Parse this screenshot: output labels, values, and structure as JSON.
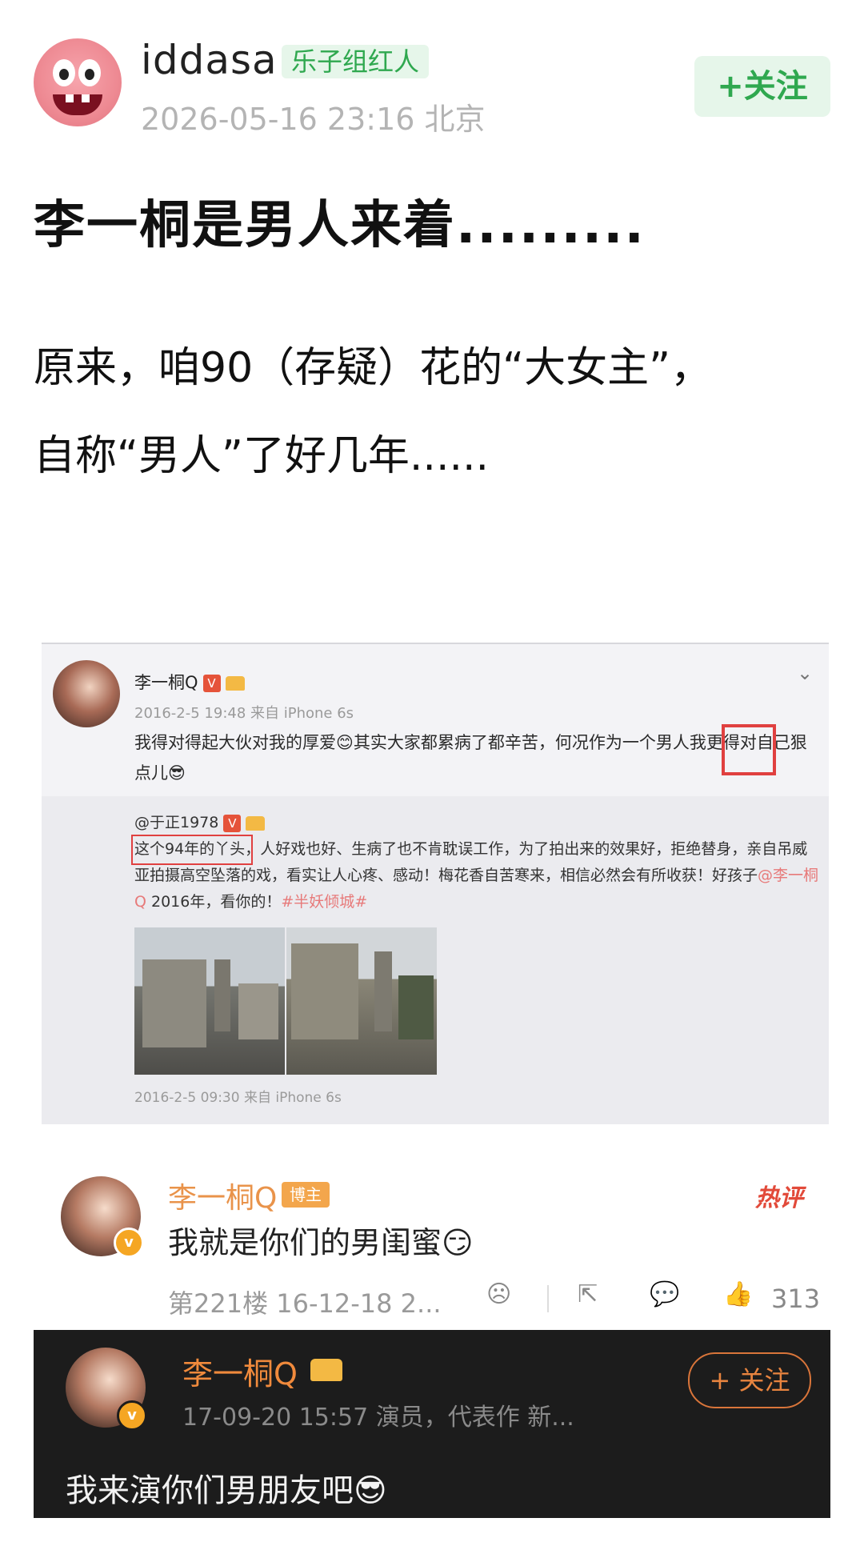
{
  "author": {
    "username": "iddasa",
    "badge": "乐子组红人",
    "meta": "2026-05-16 23:16 北京",
    "follow_label": "+关注"
  },
  "post": {
    "title": "李一桐是男人来着.........",
    "body_line1": "原来，咱90（存疑）花的“大女主”，",
    "body_line2": "自称“男人”了好几年......"
  },
  "screenshot": {
    "name": "李一桐Q",
    "v_label": "V",
    "meta": "2016-2-5 19:48 来自 iPhone 6s",
    "text": "我得对得起大伙对我的厚爱😊其实大家都累病了都辛苦，何况作为一个男人我更得对自己狠点儿😎",
    "retweet": {
      "name": "@于正1978",
      "v_label": "V",
      "text_highlight": "这个94年的丫头",
      "text_rest": "，人好戏也好、生病了也不肯耽误工作，为了拍出来的效果好，拒绝替身，亲自吊威亚拍摄高空坠落的戏，看实让人心疼、感动！梅花香自苦寒来，相信必然会有所收获！好孩子",
      "mention": "@李一桐Q",
      "text_tail": " 2016年，看你的！",
      "hashtag": "#半妖倾城#",
      "meta": "2016-2-5 09:30 来自 iPhone 6s"
    }
  },
  "comment": {
    "name": "李一桐Q",
    "badge": "博主",
    "hot_label": "热评",
    "text": "我就是你们的男闺蜜😏",
    "floor": "第221楼 16-12-18 2...",
    "like_count": "313",
    "v_label": "v"
  },
  "quoted": {
    "name": "李一桐Q",
    "meta": "17-09-20 15:57 演员，代表作 新...",
    "follow_label": "+ 关注",
    "text": "我来演你们男朋友吧😎",
    "v_label": "v"
  },
  "colors": {
    "accent_green": "#2fa84f",
    "accent_orange": "#e9934a",
    "hot_red": "#e24a3a"
  }
}
